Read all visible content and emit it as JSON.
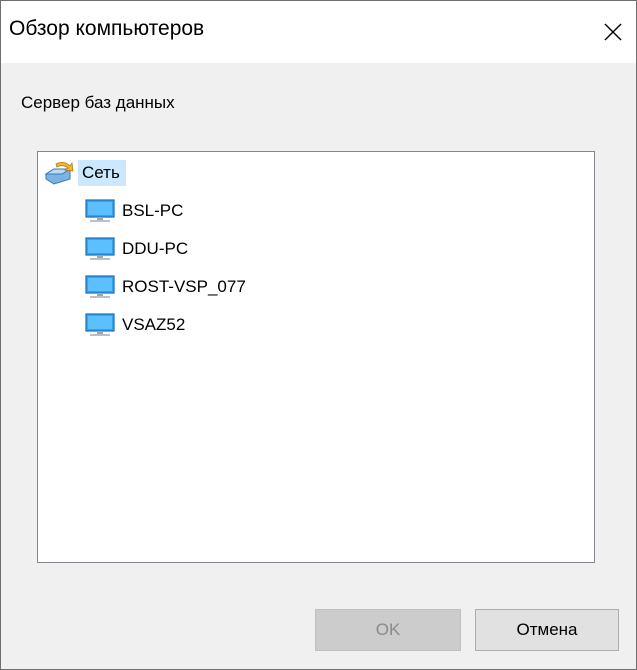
{
  "window": {
    "title": "Обзор компьютеров",
    "close_icon": "close-icon"
  },
  "subtitle": "Сервер баз данных",
  "tree": {
    "root": {
      "label": "Сеть",
      "icon": "network-icon",
      "selected": true
    },
    "items": [
      {
        "label": "BSL-PC",
        "icon": "computer-icon"
      },
      {
        "label": "DDU-PC",
        "icon": "computer-icon"
      },
      {
        "label": "ROST-VSP_077",
        "icon": "computer-icon"
      },
      {
        "label": "VSAZ52",
        "icon": "computer-icon"
      }
    ]
  },
  "buttons": {
    "ok_label": "OK",
    "ok_enabled": false,
    "cancel_label": "Отмена"
  },
  "colors": {
    "selection": "#cce8ff",
    "dialog_bg": "#f0f0f0",
    "disabled_button": "#cccccc"
  }
}
